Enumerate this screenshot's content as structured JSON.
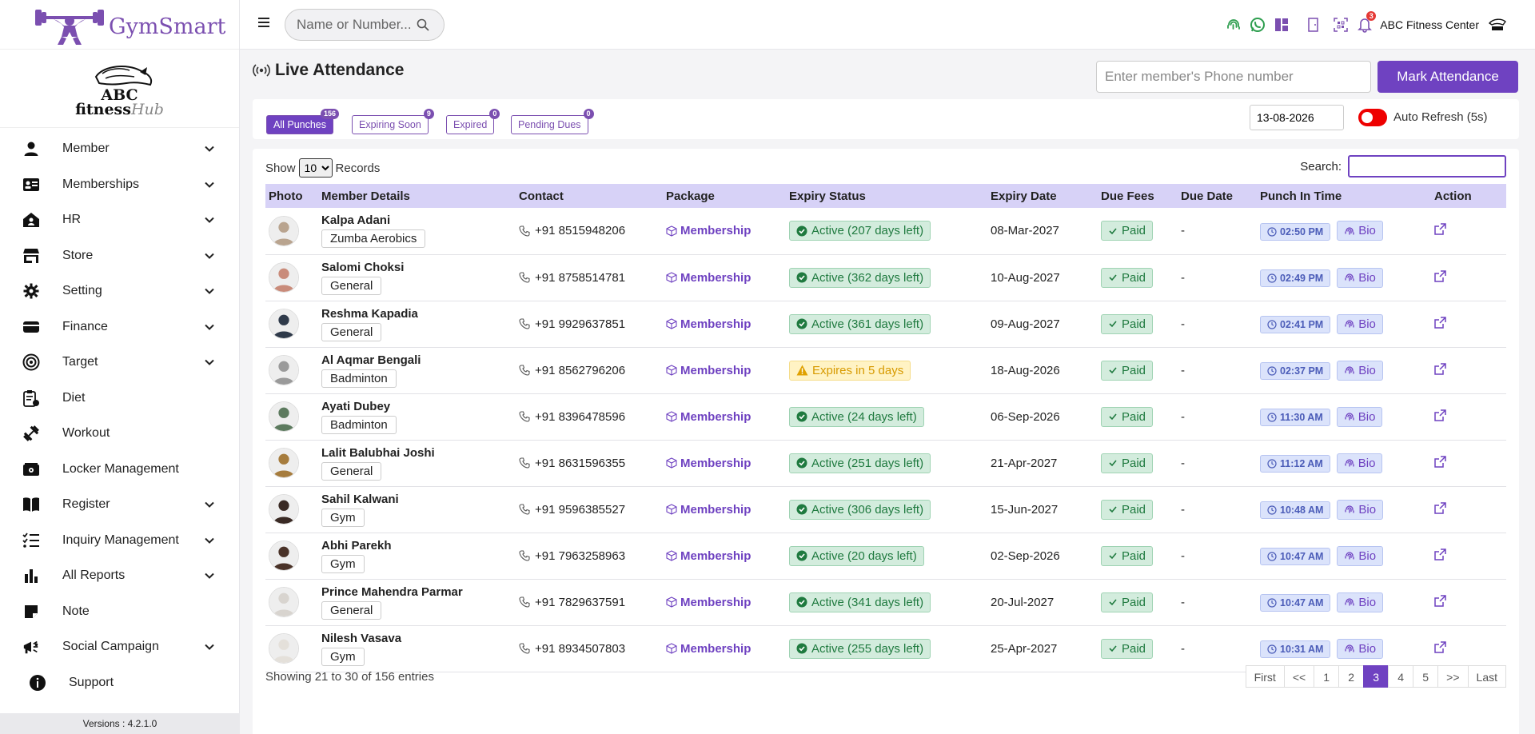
{
  "brand": {
    "name": "GymSmart",
    "gym_name_top": "ABC",
    "gym_name_main": "fitness",
    "gym_name_hub": "Hub"
  },
  "sidebar": {
    "items": [
      {
        "label": "Member",
        "icon": "user-icon",
        "chevron": true
      },
      {
        "label": "Memberships",
        "icon": "id-card-icon",
        "chevron": true
      },
      {
        "label": "HR",
        "icon": "house-user-icon",
        "chevron": true
      },
      {
        "label": "Store",
        "icon": "store-icon",
        "chevron": true
      },
      {
        "label": "Setting",
        "icon": "gear-icon",
        "chevron": true
      },
      {
        "label": "Finance",
        "icon": "wallet-icon",
        "chevron": true
      },
      {
        "label": "Target",
        "icon": "target-icon",
        "chevron": true
      },
      {
        "label": "Diet",
        "icon": "diet-clipboard-icon",
        "chevron": false
      },
      {
        "label": "Workout",
        "icon": "dumbbell-icon",
        "chevron": false
      },
      {
        "label": "Locker Management",
        "icon": "locker-icon",
        "chevron": false
      },
      {
        "label": "Register",
        "icon": "book-icon",
        "chevron": true
      },
      {
        "label": "Inquiry Management",
        "icon": "list-check-icon",
        "chevron": true
      },
      {
        "label": "All Reports",
        "icon": "bar-chart-icon",
        "chevron": true
      },
      {
        "label": "Note",
        "icon": "note-icon",
        "chevron": false
      },
      {
        "label": "Social Campaign",
        "icon": "megaphone-icon",
        "chevron": true
      },
      {
        "label": "Support",
        "icon": "info-icon",
        "chevron": false
      }
    ],
    "version": "Versions : 4.2.1.0"
  },
  "topbar": {
    "search_placeholder": "Name or Number...",
    "notification_count": "3",
    "center_name": "ABC Fitness Center"
  },
  "page": {
    "title": "Live Attendance",
    "phone_placeholder": "Enter member's Phone number",
    "mark_button": "Mark Attendance"
  },
  "filters": {
    "items": [
      {
        "label": "All Punches",
        "count": "156",
        "active": true
      },
      {
        "label": "Expiring Soon",
        "count": "9",
        "active": false
      },
      {
        "label": "Expired",
        "count": "0",
        "active": false
      },
      {
        "label": "Pending Dues",
        "count": "0",
        "active": false
      }
    ],
    "date": "13-08-2026",
    "auto_refresh_label": "Auto Refresh (5s)"
  },
  "table": {
    "show_label": "Show",
    "records_label": "Records",
    "page_size": "10",
    "search_label": "Search:",
    "columns": [
      "Photo",
      "Member Details",
      "Contact",
      "Package",
      "Expiry Status",
      "Expiry Date",
      "Due Fees",
      "Due Date",
      "Punch In Time",
      "Action"
    ],
    "rows": [
      {
        "name": "Kalpa Adani",
        "tag": "Zumba Aerobics",
        "contact": "+91 8515948206",
        "package": "Membership",
        "status": "Active (207 days left)",
        "status_type": "active",
        "expiry": "08-Mar-2027",
        "fees": "Paid",
        "due_date": "-",
        "punch": "02:50 PM",
        "method": "Bio",
        "avatar_color": "#b9a48f"
      },
      {
        "name": "Salomi Choksi",
        "tag": "General",
        "contact": "+91 8758514781",
        "package": "Membership",
        "status": "Active (362 days left)",
        "status_type": "active",
        "expiry": "10-Aug-2027",
        "fees": "Paid",
        "due_date": "-",
        "punch": "02:49 PM",
        "method": "Bio",
        "avatar_color": "#c98b7a"
      },
      {
        "name": "Reshma Kapadia",
        "tag": "General",
        "contact": "+91 9929637851",
        "package": "Membership",
        "status": "Active (361 days left)",
        "status_type": "active",
        "expiry": "09-Aug-2027",
        "fees": "Paid",
        "due_date": "-",
        "punch": "02:41 PM",
        "method": "Bio",
        "avatar_color": "#2f3a4a"
      },
      {
        "name": "Al Aqmar Bengali",
        "tag": "Badminton",
        "contact": "+91 8562796206",
        "package": "Membership",
        "status": "Expires in 5 days",
        "status_type": "warn",
        "expiry": "18-Aug-2026",
        "fees": "Paid",
        "due_date": "-",
        "punch": "02:37 PM",
        "method": "Bio",
        "avatar_color": "#9a9a9a"
      },
      {
        "name": "Ayati Dubey",
        "tag": "Badminton",
        "contact": "+91 8396478596",
        "package": "Membership",
        "status": "Active (24 days left)",
        "status_type": "active",
        "expiry": "06-Sep-2026",
        "fees": "Paid",
        "due_date": "-",
        "punch": "11:30 AM",
        "method": "Bio",
        "avatar_color": "#5c7a5e"
      },
      {
        "name": "Lalit Balubhai Joshi",
        "tag": "General",
        "contact": "+91 8631596355",
        "package": "Membership",
        "status": "Active (251 days left)",
        "status_type": "active",
        "expiry": "21-Apr-2027",
        "fees": "Paid",
        "due_date": "-",
        "punch": "11:12 AM",
        "method": "Bio",
        "avatar_color": "#a67c3d"
      },
      {
        "name": "Sahil Kalwani",
        "tag": "Gym",
        "contact": "+91 9596385527",
        "package": "Membership",
        "status": "Active (306 days left)",
        "status_type": "active",
        "expiry": "15-Jun-2027",
        "fees": "Paid",
        "due_date": "-",
        "punch": "10:48 AM",
        "method": "Bio",
        "avatar_color": "#3a2a24"
      },
      {
        "name": "Abhi Parekh",
        "tag": "Gym",
        "contact": "+91 7963258963",
        "package": "Membership",
        "status": "Active (20 days left)",
        "status_type": "active",
        "expiry": "02-Sep-2026",
        "fees": "Paid",
        "due_date": "-",
        "punch": "10:47 AM",
        "method": "Bio",
        "avatar_color": "#4a3228"
      },
      {
        "name": "Prince Mahendra Parmar",
        "tag": "General",
        "contact": "+91 7829637591",
        "package": "Membership",
        "status": "Active (341 days left)",
        "status_type": "active",
        "expiry": "20-Jul-2027",
        "fees": "Paid",
        "due_date": "-",
        "punch": "10:47 AM",
        "method": "Bio",
        "avatar_color": "#d8d4cf"
      },
      {
        "name": "Nilesh Vasava",
        "tag": "Gym",
        "contact": "+91 8934507803",
        "package": "Membership",
        "status": "Active (255 days left)",
        "status_type": "active",
        "expiry": "25-Apr-2027",
        "fees": "Paid",
        "due_date": "-",
        "punch": "10:31 AM",
        "method": "Bio",
        "avatar_color": "#e4e0da"
      }
    ],
    "entries_info": "Showing 21 to 30 of 156 entries",
    "pagination": [
      "First",
      "<<",
      "1",
      "2",
      "3",
      "4",
      "5",
      ">>",
      "Last"
    ],
    "active_page": "3"
  },
  "colors": {
    "accent": "#6f42c1",
    "active_green": "#1f7a3f",
    "warning": "#d79a00",
    "toggle_red": "#e00000"
  }
}
